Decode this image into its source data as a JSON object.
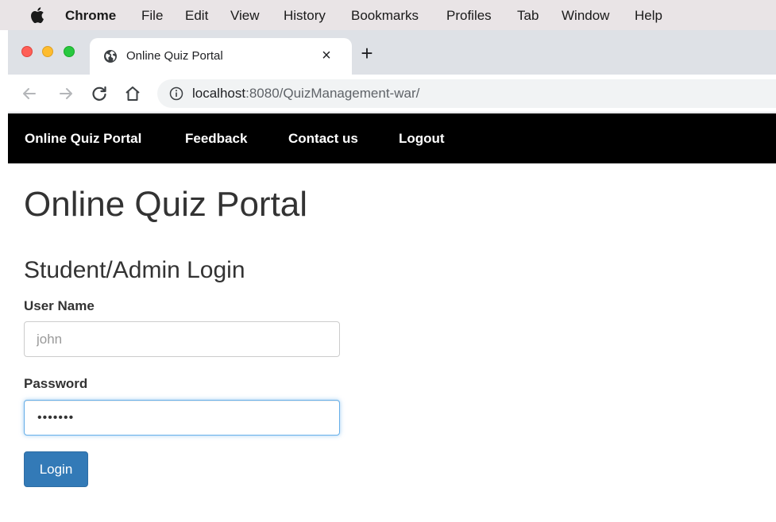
{
  "menubar": {
    "app": "Chrome",
    "items": [
      "File",
      "Edit",
      "View",
      "History",
      "Bookmarks",
      "Profiles",
      "Tab",
      "Window",
      "Help"
    ]
  },
  "browser": {
    "tab_title": "Online Quiz Portal",
    "tab_close": "×",
    "new_tab": "+",
    "url_host": "localhost",
    "url_rest": ":8080/QuizManagement-war/"
  },
  "navbar": {
    "links": [
      "Online Quiz Portal",
      "Feedback",
      "Contact us",
      "Logout"
    ]
  },
  "page": {
    "title": "Online Quiz Portal",
    "subtitle": "Student/Admin Login",
    "username_label": "User Name",
    "username_value": "john",
    "password_label": "Password",
    "password_mask": "•••••••",
    "login_label": "Login"
  },
  "colors": {
    "navbar_bg": "#000000",
    "primary_button": "#337ab7",
    "focus_ring": "#66afe9"
  }
}
